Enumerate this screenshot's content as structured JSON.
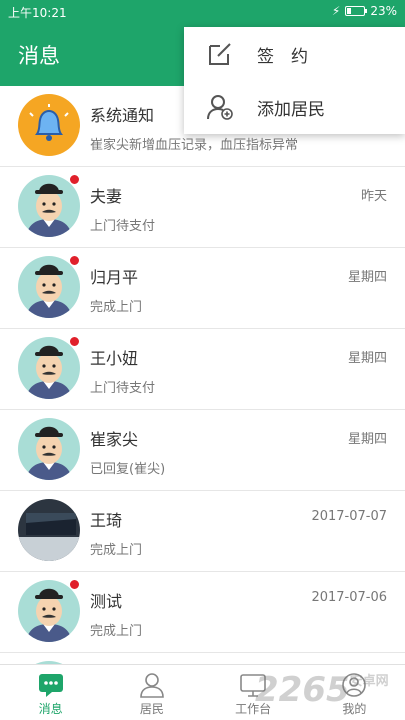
{
  "status_bar": {
    "time": "上午10:21",
    "battery": "23%",
    "battery_level": 0.23
  },
  "header": {
    "title": "消息"
  },
  "menu": {
    "items": [
      {
        "label": "签　约",
        "icon": "sign-edit-icon"
      },
      {
        "label": "添加居民",
        "icon": "add-resident-icon"
      }
    ]
  },
  "messages": [
    {
      "name": "系统通知",
      "preview": "崔家尖新增血压记录，血压指标异常",
      "time": "",
      "avatar": "bell-icon",
      "unread": false
    },
    {
      "name": "夫妻",
      "preview": "上门待支付",
      "time": "昨天",
      "avatar": "man-avatar",
      "unread": true
    },
    {
      "name": "归月平",
      "preview": "完成上门",
      "time": "星期四",
      "avatar": "man-avatar",
      "unread": true
    },
    {
      "name": "王小妞",
      "preview": "上门待支付",
      "time": "星期四",
      "avatar": "man-avatar",
      "unread": true
    },
    {
      "name": "崔家尖",
      "preview": "已回复(崔尖)",
      "time": "星期四",
      "avatar": "man-avatar",
      "unread": false
    },
    {
      "name": "王琦",
      "preview": "完成上门",
      "time": "2017-07-07",
      "avatar": "photo-avatar",
      "unread": false
    },
    {
      "name": "测试",
      "preview": "完成上门",
      "time": "2017-07-06",
      "avatar": "man-avatar",
      "unread": true
    }
  ],
  "tabs": [
    {
      "label": "消息",
      "icon": "message-icon",
      "active": true
    },
    {
      "label": "居民",
      "icon": "person-icon",
      "active": false
    },
    {
      "label": "工作台",
      "icon": "monitor-icon",
      "active": false
    },
    {
      "label": "我的",
      "icon": "user-icon",
      "active": false
    }
  ],
  "watermark": {
    "text": "2265",
    "suffix": "安卓网"
  },
  "colors": {
    "brand": "#1ea56a",
    "unread": "#e0202b",
    "bell_bg": "#f5a623"
  }
}
